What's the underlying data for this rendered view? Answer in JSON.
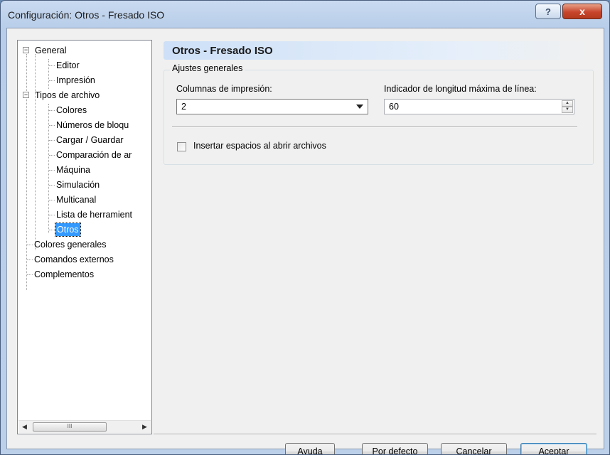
{
  "window": {
    "title": "Configuración: Otros - Fresado ISO",
    "help_label": "?",
    "close_label": "x"
  },
  "tree": {
    "items": [
      {
        "label": "General",
        "expander": "−"
      },
      {
        "label": "Editor"
      },
      {
        "label": "Impresión"
      },
      {
        "label": "Tipos de archivo",
        "expander": "−"
      },
      {
        "label": "Colores"
      },
      {
        "label": "Números de bloqu"
      },
      {
        "label": "Cargar / Guardar"
      },
      {
        "label": "Comparación de ar"
      },
      {
        "label": "Máquina"
      },
      {
        "label": "Simulación"
      },
      {
        "label": "Multicanal"
      },
      {
        "label": "Lista de herramient"
      },
      {
        "label": "Otros",
        "selected": true
      },
      {
        "label": "Colores generales"
      },
      {
        "label": "Comandos externos"
      },
      {
        "label": "Complementos"
      }
    ],
    "hscroll_grip": "III"
  },
  "panel": {
    "header": "Otros - Fresado ISO",
    "group_label": "Ajustes generales",
    "print_columns_label": "Columnas de impresión:",
    "print_columns_value": "2",
    "max_line_label": "Indicador de longitud máxima de línea:",
    "max_line_value": "60",
    "insert_spaces_label": "Insertar espacios al abrir archivos",
    "insert_spaces_checked": false
  },
  "buttons": {
    "help": "Ayuda",
    "defaults": "Por defecto",
    "cancel": "Cancelar",
    "accept": "Aceptar"
  },
  "colors": {
    "selection": "#3399ff",
    "header_gradient": "#cde0f7",
    "close_button": "#c7452c"
  }
}
